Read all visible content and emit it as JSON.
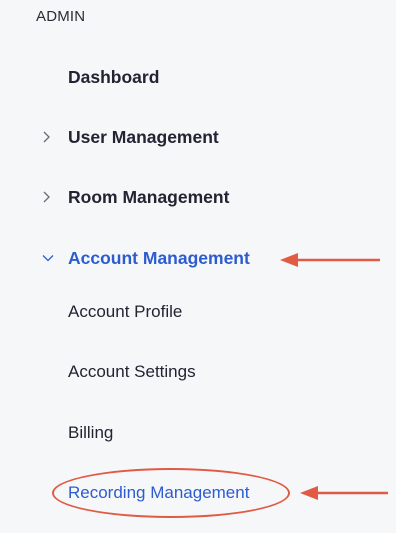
{
  "sidebar": {
    "section_label": "ADMIN",
    "items": [
      {
        "label": "Dashboard",
        "chevron": "none"
      },
      {
        "label": "User Management",
        "chevron": "right"
      },
      {
        "label": "Room Management",
        "chevron": "right"
      },
      {
        "label": "Account Management",
        "chevron": "down",
        "expanded": true,
        "active": true
      }
    ],
    "sub_items": [
      {
        "label": "Account Profile"
      },
      {
        "label": "Account Settings"
      },
      {
        "label": "Billing"
      },
      {
        "label": "Recording Management",
        "active": true
      }
    ]
  },
  "annotations": {
    "arrow_color": "#e05a44",
    "circle_color": "#e05a44"
  },
  "colors": {
    "active": "#2d5bd0",
    "text": "#232333",
    "background": "#f6f7f9"
  }
}
